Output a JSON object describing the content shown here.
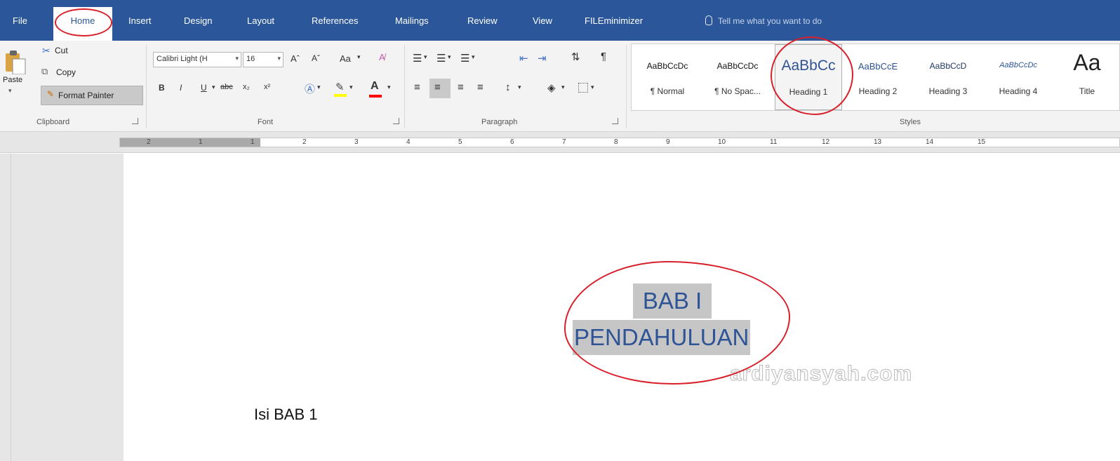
{
  "ribbon_tabs": [
    {
      "label": "File"
    },
    {
      "label": "Home"
    },
    {
      "label": "Insert"
    },
    {
      "label": "Design"
    },
    {
      "label": "Layout"
    },
    {
      "label": "References"
    },
    {
      "label": "Mailings"
    },
    {
      "label": "Review"
    },
    {
      "label": "View"
    },
    {
      "label": "FILEminimizer"
    }
  ],
  "tell_me": {
    "placeholder": "Tell me what you want to do"
  },
  "clipboard": {
    "group_label": "Clipboard",
    "paste_label": "Paste",
    "cut_label": "Cut",
    "copy_label": "Copy",
    "format_painter_label": "Format Painter"
  },
  "font": {
    "group_label": "Font",
    "font_name": "Calibri Light (H",
    "font_size": "16",
    "grow_label": "Aˆ",
    "shrink_label": "Aˇ",
    "change_case_label": "Aa",
    "bold": "B",
    "italic": "I",
    "underline": "U",
    "strikethrough": "abc",
    "subscript": "x₂",
    "superscript": "x²",
    "font_color_label": "A"
  },
  "paragraph": {
    "group_label": "Paragraph",
    "pilcrow": "¶"
  },
  "styles": {
    "group_label": "Styles",
    "items": [
      {
        "sample": "AaBbCcDc",
        "name": "¶ Normal"
      },
      {
        "sample": "AaBbCcDc",
        "name": "¶ No Spac..."
      },
      {
        "sample": "AaBbCc",
        "name": "Heading 1"
      },
      {
        "sample": "AaBbCcE",
        "name": "Heading 2"
      },
      {
        "sample": "AaBbCcD",
        "name": "Heading 3"
      },
      {
        "sample": "AaBbCcDc",
        "name": "Heading 4"
      },
      {
        "sample": "Aa",
        "name": "Title"
      }
    ]
  },
  "ruler": {
    "numbers": [
      "2",
      "1",
      "1",
      "2",
      "3",
      "4",
      "5",
      "6",
      "7",
      "8",
      "9",
      "10",
      "11",
      "12",
      "13",
      "14",
      "15"
    ]
  },
  "document": {
    "heading_line1": "BAB I",
    "heading_line2": "PENDAHULUAN",
    "body_text": "Isi BAB 1",
    "watermark": "ardiyansyah.com"
  },
  "colors": {
    "ribbon_blue": "#2b579a",
    "heading_text": "#2f5496",
    "annotation_red": "#d8202b",
    "selection_gray": "#c6c6c6"
  }
}
